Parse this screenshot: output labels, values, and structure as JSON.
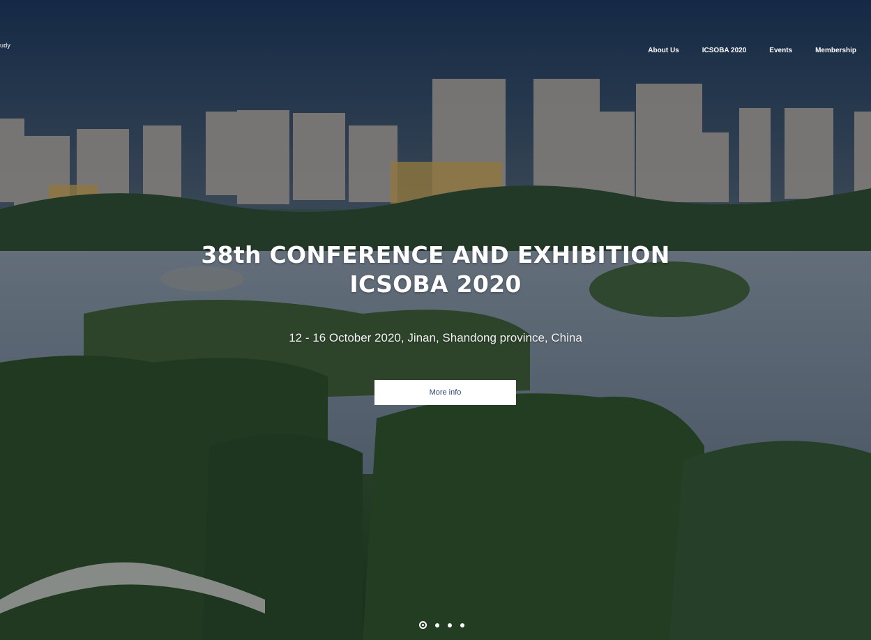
{
  "brand": {
    "fragment": "udy"
  },
  "nav": {
    "items": [
      {
        "label": "About Us"
      },
      {
        "label": "ICSOBA 2020"
      },
      {
        "label": "Events"
      },
      {
        "label": "Membership"
      }
    ]
  },
  "hero": {
    "title_line1": "38th CONFERENCE AND EXHIBITION",
    "title_line2": "ICSOBA 2020",
    "subtitle": "12 - 16 October 2020, Jinan, Shandong province, China",
    "button_label": "More info"
  },
  "carousel": {
    "slide_count": 4,
    "active_index": 0
  },
  "colors": {
    "button_text": "#2d4a73",
    "overlay_sky": "#1b3556"
  },
  "icons": {
    "indicator": "carousel-dot-icon"
  }
}
